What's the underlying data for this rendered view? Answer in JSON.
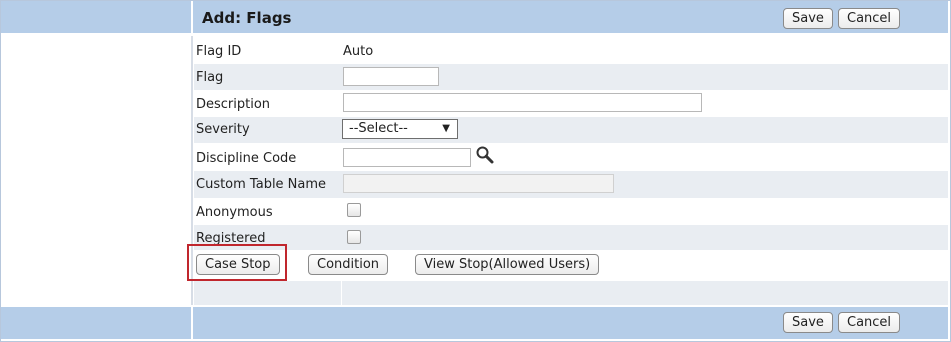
{
  "header": {
    "title": "Add: Flags",
    "save_label": "Save",
    "cancel_label": "Cancel"
  },
  "form": {
    "flag_id": {
      "label": "Flag ID",
      "value": "Auto"
    },
    "flag": {
      "label": "Flag",
      "value": ""
    },
    "description": {
      "label": "Description",
      "value": ""
    },
    "severity": {
      "label": "Severity",
      "selected": "--Select--"
    },
    "discipline_code": {
      "label": "Discipline Code",
      "value": ""
    },
    "custom_table_name": {
      "label": "Custom Table Name",
      "value": ""
    },
    "anonymous": {
      "label": "Anonymous",
      "checked": false
    },
    "registered": {
      "label": "Registered",
      "checked": false
    }
  },
  "actions": {
    "case_stop": "Case Stop",
    "condition": "Condition",
    "view_stop": "View Stop(Allowed Users)"
  },
  "footer": {
    "save_label": "Save",
    "cancel_label": "Cancel"
  },
  "colors": {
    "header_bar": "#b5cde8",
    "alt_row": "#e9edf2",
    "highlight": "#c0262d"
  }
}
